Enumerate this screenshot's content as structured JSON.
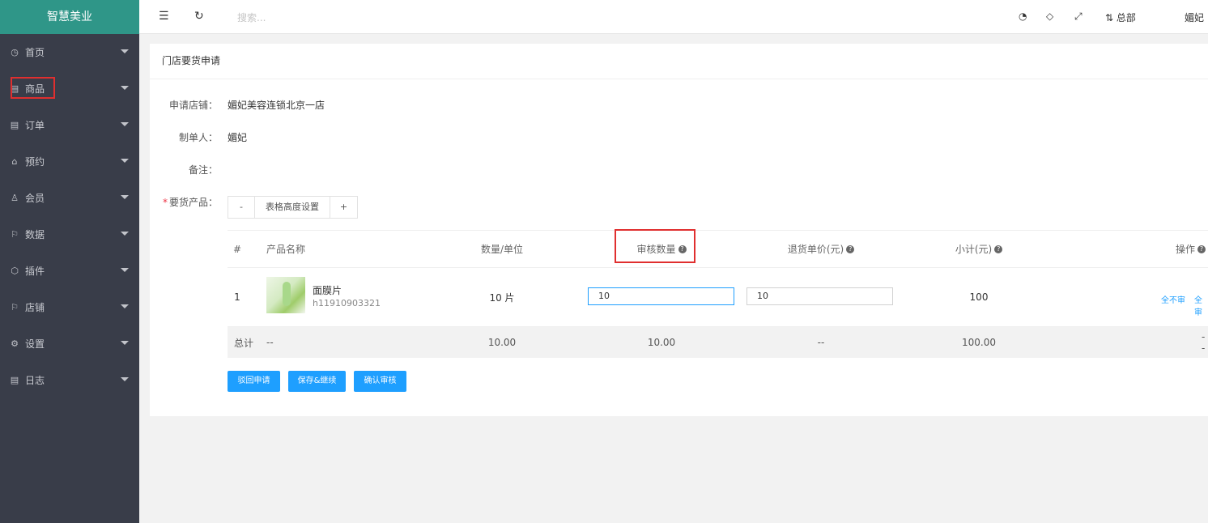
{
  "app": {
    "title": "智慧美业"
  },
  "sidebar": {
    "items": [
      {
        "label": "首页",
        "icon": "dashboard-icon"
      },
      {
        "label": "商品",
        "icon": "goods-icon"
      },
      {
        "label": "订单",
        "icon": "order-icon"
      },
      {
        "label": "预约",
        "icon": "home-icon"
      },
      {
        "label": "会员",
        "icon": "user-icon"
      },
      {
        "label": "数据",
        "icon": "flag-icon"
      },
      {
        "label": "插件",
        "icon": "plugin-icon"
      },
      {
        "label": "店铺",
        "icon": "flag-icon"
      },
      {
        "label": "设置",
        "icon": "gear-icon"
      },
      {
        "label": "日志",
        "icon": "log-icon"
      }
    ]
  },
  "topbar": {
    "search_placeholder": "搜索...",
    "branch_label": "总部",
    "user_label": "媚妃"
  },
  "card": {
    "title": "门店要货申请"
  },
  "form": {
    "store_label": "申请店铺：",
    "store_value": "媚妃美容连锁北京一店",
    "maker_label": "制单人：",
    "maker_value": "媚妃",
    "remark_label": "备注：",
    "remark_value": "",
    "products_label": "要货产品：",
    "required_mark": "*",
    "height_minus": "-",
    "height_label": "表格高度设置",
    "height_plus": "+"
  },
  "table": {
    "headers": {
      "index": "#",
      "name": "产品名称",
      "qty": "数量/单位",
      "audit_qty": "审核数量",
      "return_price": "退货单价(元)",
      "subtotal": "小计(元)",
      "ops": "操作"
    },
    "help_icon": "?",
    "rows": [
      {
        "index": "1",
        "name": "面膜片",
        "code": "h11910903321",
        "qty": "10 片",
        "audit_qty": "10",
        "return_price": "10",
        "subtotal": "100",
        "op_none": "全不审",
        "op_all": "全审"
      }
    ],
    "footer": {
      "label": "总计",
      "name": "--",
      "qty": "10.00",
      "audit_qty": "10.00",
      "return_price": "--",
      "subtotal": "100.00",
      "ops": "--"
    }
  },
  "actions": {
    "reject": "驳回申请",
    "save_continue": "保存&继续",
    "confirm": "确认审核"
  },
  "colors": {
    "accent": "#1e9fff",
    "sidebar_bg": "#393d49",
    "logo_bg": "#2f9688",
    "highlight": "#e02f2f"
  }
}
